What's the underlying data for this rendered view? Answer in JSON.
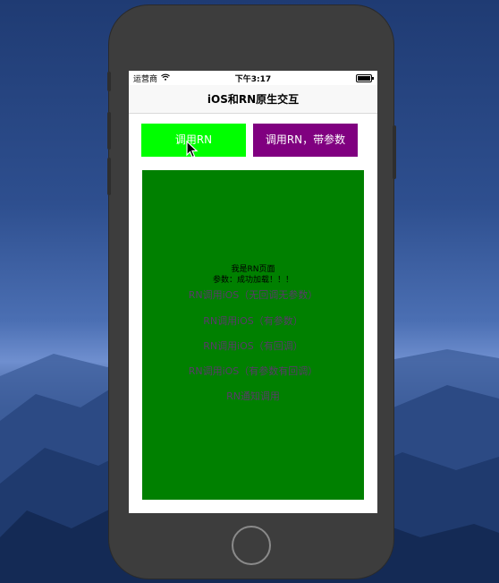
{
  "status_bar": {
    "carrier": "运营商",
    "time": "下午3:17"
  },
  "nav": {
    "title": "iOS和RN原生交互"
  },
  "buttons": {
    "call_rn": "调用RN",
    "call_rn_with_param": "调用RN，带参数"
  },
  "rn_view": {
    "title": "我是RN页面",
    "param": "参数：成功加载！！！",
    "actions": [
      "RN调用iOS（无回调无参数）",
      "RN调用iOS（有参数）",
      "RN调用iOS（有回调）",
      "RN调用iOS（有参数有回调）",
      "RN通知调用"
    ]
  },
  "colors": {
    "call_rn_button": "#00ff00",
    "call_rn_with_param_button": "#800080",
    "rn_view_background": "#008000"
  }
}
